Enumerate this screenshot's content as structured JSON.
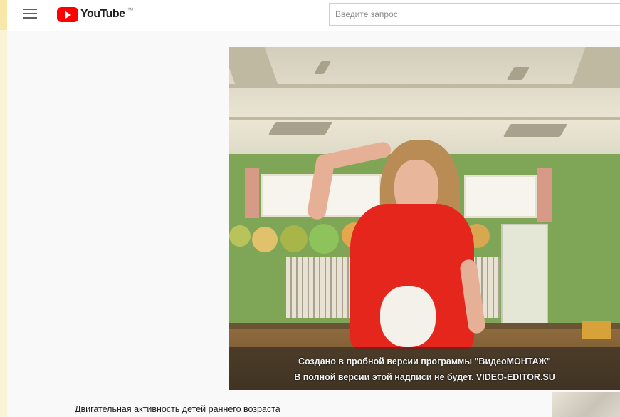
{
  "youtube": {
    "logo_text": "YouTube",
    "logo_superscript": "™"
  },
  "search": {
    "placeholder": "Введите запрос"
  },
  "video": {
    "overlay_line1": "Создано в пробной версии программы \"ВидеоМОНТАЖ\"",
    "overlay_line2": "В полной версии этой надписи не будет. VIDEO-EDITOR.SU",
    "title": "Двигательная активность детей раннего возраста"
  },
  "colors": {
    "slide_background": "#fbf3d8",
    "youtube_red": "#ff0000",
    "shirt_red": "#e5261d",
    "wall_green": "#7fa556"
  },
  "icons": {
    "menu": "hamburger-menu-icon",
    "logo": "youtube-play-icon"
  }
}
